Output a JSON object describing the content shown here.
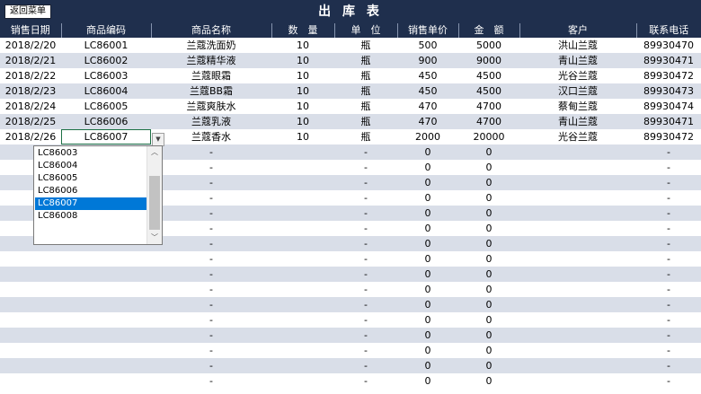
{
  "toolbar": {
    "back_label": "返回菜单",
    "title": "出 库 表"
  },
  "columns": [
    "销售日期",
    "商品编码",
    "商品名称",
    "数　量",
    "单　位",
    "销售单价",
    "金　额",
    "客户",
    "联系电话"
  ],
  "rows": [
    [
      "2018/2/20",
      "LC86001",
      "兰蔻洗面奶",
      "10",
      "瓶",
      "500",
      "5000",
      "洪山兰蔻",
      "89930470"
    ],
    [
      "2018/2/21",
      "LC86002",
      "兰蔻精华液",
      "10",
      "瓶",
      "900",
      "9000",
      "青山兰蔻",
      "89930471"
    ],
    [
      "2018/2/22",
      "LC86003",
      "兰蔻眼霜",
      "10",
      "瓶",
      "450",
      "4500",
      "光谷兰蔻",
      "89930472"
    ],
    [
      "2018/2/23",
      "LC86004",
      "兰蔻BB霜",
      "10",
      "瓶",
      "450",
      "4500",
      "汉口兰蔻",
      "89930473"
    ],
    [
      "2018/2/24",
      "LC86005",
      "兰蔻爽肤水",
      "10",
      "瓶",
      "470",
      "4700",
      "蔡甸兰蔻",
      "89930474"
    ],
    [
      "2018/2/25",
      "LC86006",
      "兰蔻乳液",
      "10",
      "瓶",
      "470",
      "4700",
      "青山兰蔻",
      "89930471"
    ],
    [
      "2018/2/26",
      "LC86007",
      "兰蔻香水",
      "10",
      "瓶",
      "2000",
      "20000",
      "光谷兰蔻",
      "89930472"
    ]
  ],
  "empty_row": [
    "",
    "",
    "-",
    "",
    "-",
    "0",
    "0",
    "",
    "-"
  ],
  "empty_row_count": 16,
  "dropdown": {
    "items": [
      "LC86003",
      "LC86004",
      "LC86005",
      "LC86006",
      "LC86007",
      "LC86008"
    ],
    "selected_index": 4
  },
  "icons": {
    "dropdown_arrow": "chevron-down-icon",
    "scroll_up": "chevron-up-icon",
    "scroll_down": "chevron-down-icon"
  },
  "colors": {
    "header_bg": "#1f2f4d",
    "stripe": "#d9dee8",
    "selection": "#0078d7",
    "active_cell_border": "#1e7145"
  }
}
